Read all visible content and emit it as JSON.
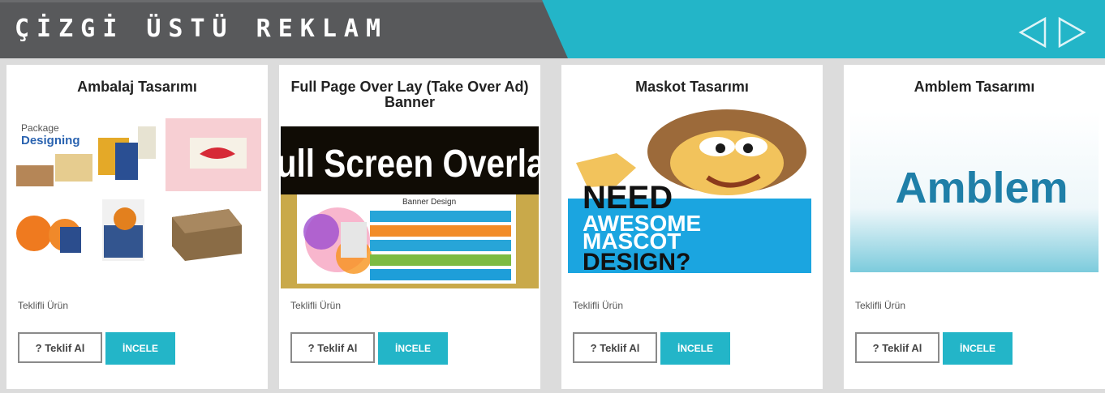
{
  "header": {
    "title": "ÇİZGİ ÜSTÜ REKLAM",
    "prev_arrow": "chevron-left-icon",
    "next_arrow": "chevron-right-icon"
  },
  "colors": {
    "accent": "#23b5c8",
    "header_dark": "#58595b"
  },
  "products": [
    {
      "title": "Ambalaj Tasarımı",
      "image_text": [
        "Package",
        "Designing"
      ],
      "label": "Teklifli Ürün",
      "quote_button": "? Teklif Al",
      "inspect_button": "İNCELE"
    },
    {
      "title": "Full Page Over Lay (Take Over Ad) Banner",
      "image_text": [
        "Full Screen Overlay",
        "Banner Design"
      ],
      "label": "Teklifli Ürün",
      "quote_button": "? Teklif Al",
      "inspect_button": "İNCELE"
    },
    {
      "title": "Maskot Tasarımı",
      "image_text": [
        "NEED",
        "AWESOME",
        "MASCOT",
        "DESIGN?"
      ],
      "label": "Teklifli Ürün",
      "quote_button": "? Teklif Al",
      "inspect_button": "İNCELE"
    },
    {
      "title": "Amblem Tasarımı",
      "image_text": [
        "Amblem"
      ],
      "label": "Teklifli Ürün",
      "quote_button": "? Teklif Al",
      "inspect_button": "İNCELE"
    }
  ]
}
